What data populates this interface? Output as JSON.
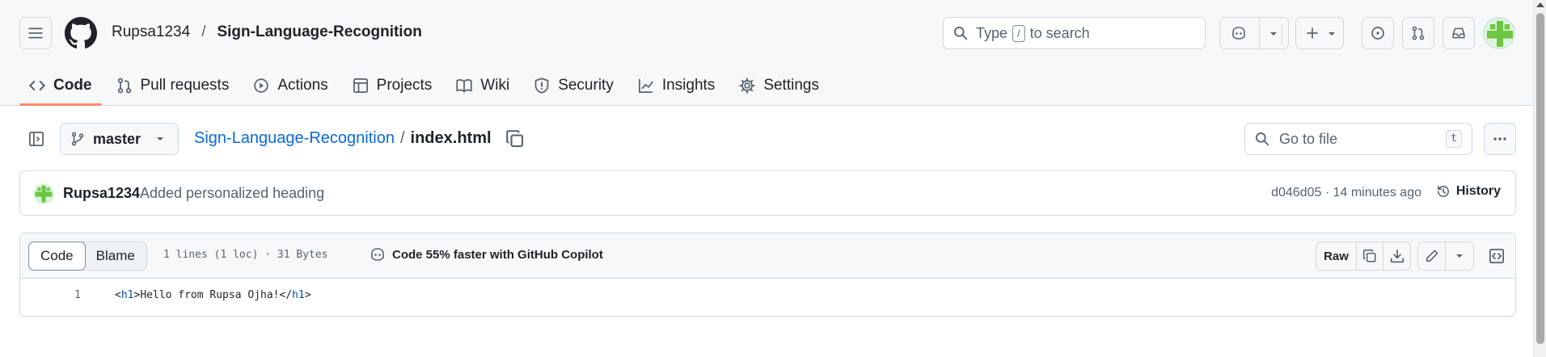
{
  "header": {
    "owner": "Rupsa1234",
    "separator": "/",
    "repo": "Sign-Language-Recognition",
    "search": {
      "prefix": "Type",
      "key": "/",
      "suffix": "to search"
    }
  },
  "nav": {
    "tabs": [
      {
        "label": "Code",
        "icon": "code-icon",
        "active": true
      },
      {
        "label": "Pull requests",
        "icon": "git-pull-request-icon"
      },
      {
        "label": "Actions",
        "icon": "play-icon"
      },
      {
        "label": "Projects",
        "icon": "table-icon"
      },
      {
        "label": "Wiki",
        "icon": "book-icon"
      },
      {
        "label": "Security",
        "icon": "shield-icon"
      },
      {
        "label": "Insights",
        "icon": "graph-icon"
      },
      {
        "label": "Settings",
        "icon": "gear-icon"
      }
    ]
  },
  "file_header": {
    "branch": "master",
    "repo_link": "Sign-Language-Recognition",
    "slash": "/",
    "file_name": "index.html",
    "goto_placeholder": "Go to file",
    "goto_key": "t"
  },
  "commit": {
    "author": "Rupsa1234",
    "message": "Added personalized heading",
    "meta": "d046d05 · 14 minutes ago",
    "history_label": "History"
  },
  "code_view": {
    "tabs": {
      "code": "Code",
      "blame": "Blame"
    },
    "lines_info": "1 lines (1 loc) · 31 Bytes",
    "copilot_note": "Code 55% faster with GitHub Copilot",
    "raw_label": "Raw",
    "line_number": "1",
    "line": {
      "open_lt": "<",
      "open_tag": "h1",
      "open_gt": ">",
      "text": "Hello from Rupsa Ojha!",
      "close_lt": "</",
      "close_tag": "h1",
      "close_gt": ">"
    }
  },
  "colors": {
    "accent_link": "#0969da",
    "active_underline": "#fd8c73",
    "avatar_green": "#6cc644"
  }
}
